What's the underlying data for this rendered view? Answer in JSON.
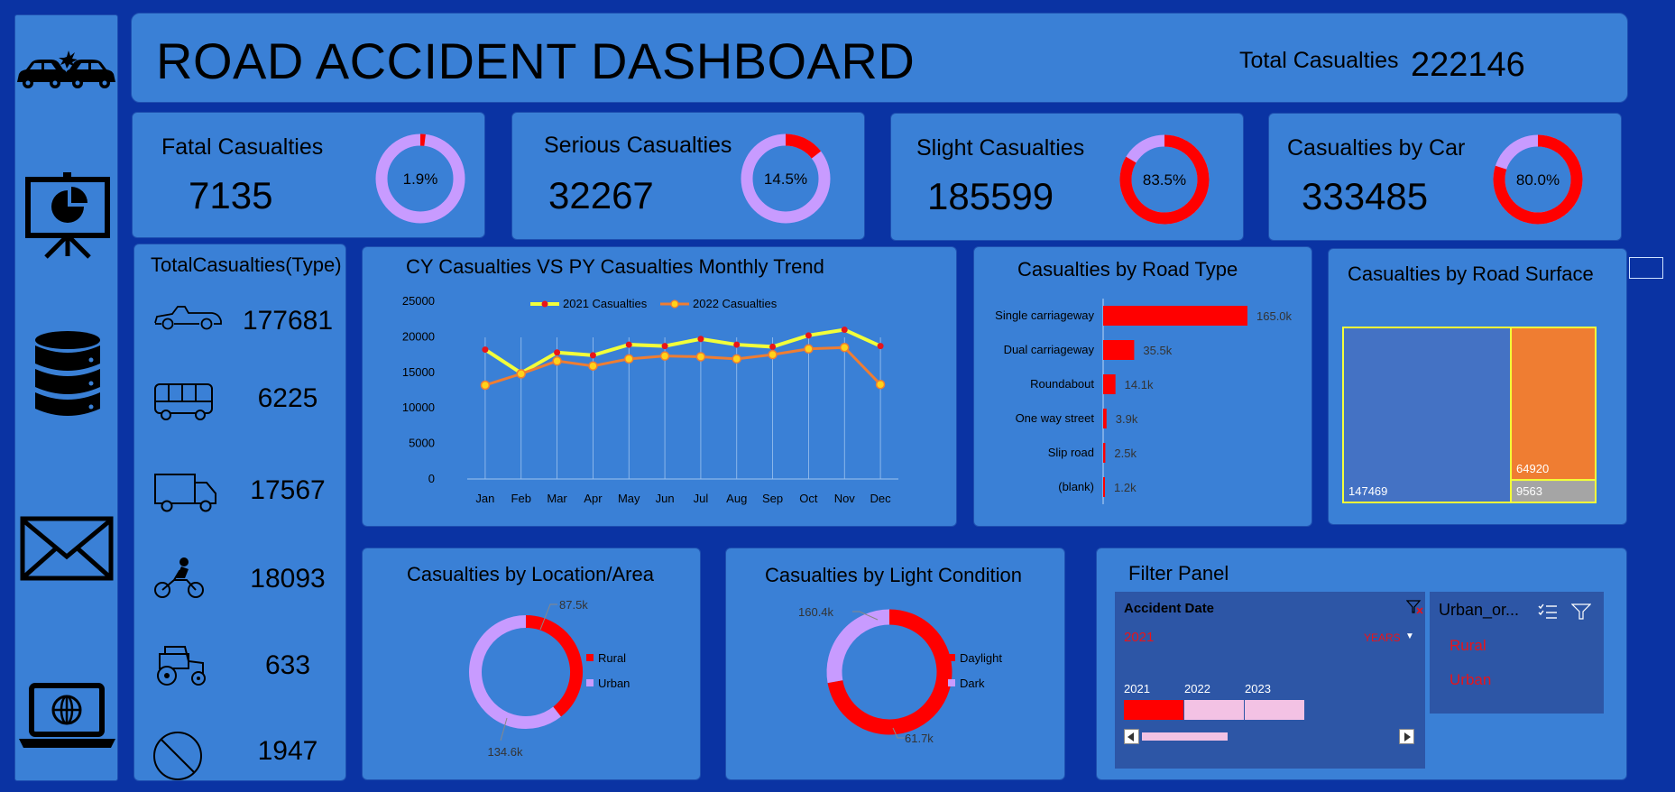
{
  "title": "ROAD ACCIDENT DASHBOARD",
  "total": {
    "label": "Total Casualties",
    "value": "222146"
  },
  "kpis": [
    {
      "label": "Fatal Casualties",
      "value": "7135",
      "pct_label": "1.9%",
      "pct": 1.9
    },
    {
      "label": "Serious Casualties",
      "value": "32267",
      "pct_label": "14.5%",
      "pct": 14.5
    },
    {
      "label": "Slight Casualties",
      "value": "185599",
      "pct_label": "83.5%",
      "pct": 83.5
    },
    {
      "label": "Casualties by Car",
      "value": "333485",
      "pct_label": "80.0%",
      "pct": 80.0
    }
  ],
  "colors": {
    "red": "#ff0000",
    "lavender": "#c89bff",
    "yellow": "#f2ff3a",
    "orange": "#ef7d32",
    "treemap_blue": "#4472c4",
    "treemap_grey": "#a5a5a5"
  },
  "type_panel": {
    "title": "TotalCasualties(Type)",
    "items": [
      {
        "icon": "car-icon",
        "value": "177681"
      },
      {
        "icon": "bus-icon",
        "value": "6225"
      },
      {
        "icon": "truck-icon",
        "value": "17567"
      },
      {
        "icon": "motorcycle-icon",
        "value": "18093"
      },
      {
        "icon": "tractor-icon",
        "value": "633"
      },
      {
        "icon": "no-entry-icon",
        "value": "1947"
      }
    ]
  },
  "chart_data": [
    {
      "id": "monthly",
      "type": "line",
      "title": "CY Casualties VS PY Casualties Monthly Trend",
      "categories": [
        "Jan",
        "Feb",
        "Mar",
        "Apr",
        "May",
        "Jun",
        "Jul",
        "Aug",
        "Sep",
        "Oct",
        "Nov",
        "Dec"
      ],
      "series": [
        {
          "name": "2021 Casualties",
          "color": "#f2ff3a",
          "values": [
            18200,
            14900,
            17800,
            17400,
            18900,
            18700,
            19700,
            18900,
            18600,
            20200,
            21000,
            18700
          ]
        },
        {
          "name": "2022 Casualties",
          "color": "#ef7d32",
          "values": [
            13200,
            14800,
            16600,
            15900,
            16900,
            17300,
            17200,
            16900,
            17500,
            18300,
            18500,
            13300
          ]
        }
      ],
      "ylim": [
        0,
        25000
      ],
      "yticks": [
        "0",
        "5000",
        "10000",
        "15000",
        "20000",
        "25000"
      ],
      "legend": "top-center",
      "grid": "vertical"
    },
    {
      "id": "road_type",
      "type": "bar",
      "orientation": "horizontal",
      "title": "Casualties by Road Type",
      "categories": [
        "Single carriageway",
        "Dual carriageway",
        "Roundabout",
        "One way street",
        "Slip road",
        "(blank)"
      ],
      "values": [
        165.0,
        35.5,
        14.1,
        3.9,
        2.5,
        1.2
      ],
      "labels": [
        "165.0k",
        "35.5k",
        "14.1k",
        "3.9k",
        "2.5k",
        "1.2k"
      ],
      "color": "#ff0000"
    },
    {
      "id": "road_surface",
      "type": "treemap",
      "title": "Casualties by Road Surface",
      "values": [
        147469,
        64920,
        9563
      ],
      "labels": [
        "147469",
        "64920",
        "9563"
      ],
      "colors": [
        "#4472c4",
        "#ef7d32",
        "#a5a5a5"
      ]
    },
    {
      "id": "location",
      "type": "pie",
      "title": "Casualties by Location/Area",
      "categories": [
        "Rural",
        "Urban"
      ],
      "values": [
        87.5,
        134.6
      ],
      "labels": [
        "87.5k",
        "134.6k"
      ],
      "colors": [
        "#ff0000",
        "#c89bff"
      ]
    },
    {
      "id": "light",
      "type": "pie",
      "title": "Casualties by Light Condition",
      "categories": [
        "Daylight",
        "Dark"
      ],
      "values": [
        160.4,
        61.7
      ],
      "labels": [
        "160.4k",
        "61.7k"
      ],
      "colors": [
        "#ff0000",
        "#c89bff"
      ]
    }
  ],
  "filter": {
    "title": "Filter Panel",
    "date_title": "Accident Date",
    "selected_year": "2021",
    "period": "YEARS",
    "years": [
      "2021",
      "2022",
      "2023"
    ],
    "urban_title": "Urban_or...",
    "urban_items": [
      "Rural",
      "Urban"
    ]
  }
}
